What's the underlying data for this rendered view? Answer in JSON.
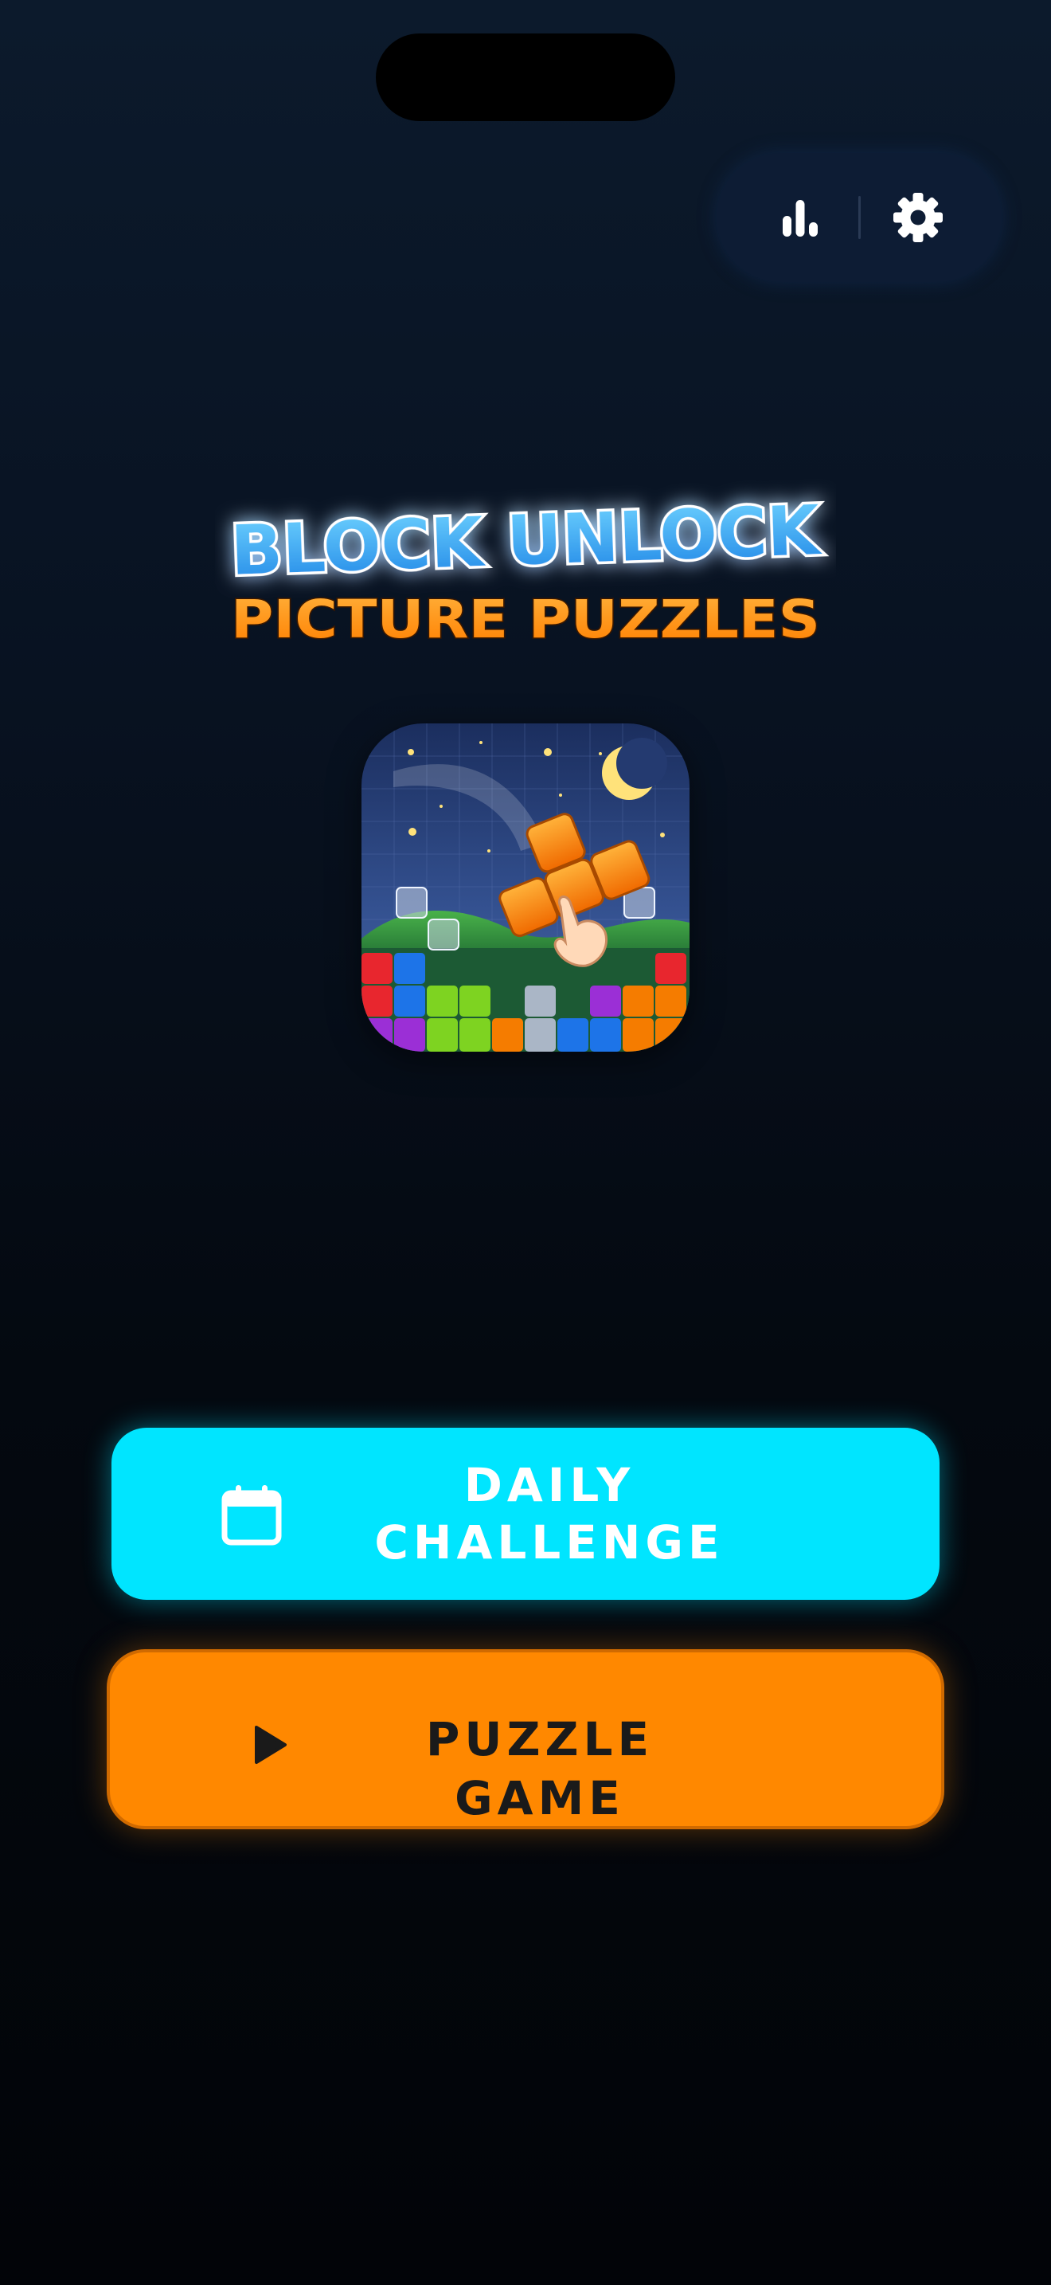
{
  "logo": {
    "title_line_1": "BLOCK UNLOCK",
    "title_line_2": "PICTURE PUZZLES"
  },
  "top_bar": {
    "stats_icon": "leaderboard-bars-icon",
    "settings_icon": "gear-icon"
  },
  "hero": {
    "image": "block-puzzle-night-scene"
  },
  "buttons": {
    "daily_label": "DAILY\nCHALLENGE",
    "daily_icon": "calendar-icon",
    "puzzle_label": "PUZZLE GAME",
    "puzzle_icon": "play-icon"
  },
  "colors": {
    "background": "#060b16",
    "pill": "#0d1c34",
    "daily_button": "#00e5ff",
    "puzzle_button": "#ff8800",
    "title_blue": "#2fa8ff",
    "title_orange": "#ff9a1a"
  }
}
